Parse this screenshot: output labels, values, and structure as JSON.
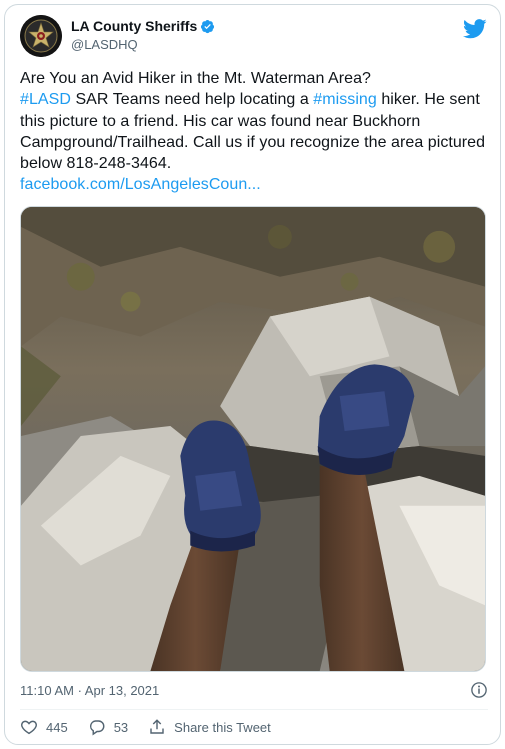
{
  "author": {
    "display_name": "LA County Sheriffs",
    "handle": "@LASDHQ",
    "verified_icon": "verified-badge-icon",
    "platform_icon": "twitter-bird-icon"
  },
  "tweet": {
    "line1": "Are You an Avid Hiker in the Mt. Waterman Area?",
    "hashtag_lasd": "#LASD",
    "text_a": " SAR Teams need help locating a ",
    "hashtag_missing": "#missing",
    "text_b": " hiker. He sent this picture to a friend. His car was found near Buckhorn Campground/Trailhead. Call us if you recognize the area pictured below 818-248-3464.",
    "link": "facebook.com/LosAngelesCoun..."
  },
  "meta": {
    "timestamp": "11:10 AM · Apr 13, 2021",
    "info_icon": "info-icon"
  },
  "actions": {
    "likes": "445",
    "replies": "53",
    "share_label": "Share this Tweet"
  },
  "colors": {
    "accent": "#1d9bf0",
    "text": "#0f1419",
    "muted": "#536471",
    "border": "#cfd9de"
  }
}
